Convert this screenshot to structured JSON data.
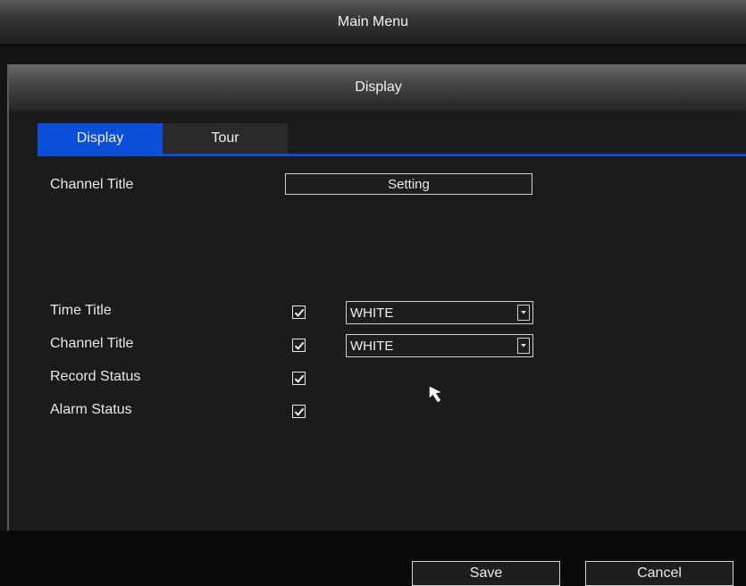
{
  "main_menu": {
    "title": "Main Menu"
  },
  "dialog": {
    "title": "Display",
    "tabs": [
      {
        "label": "Display",
        "active": true
      },
      {
        "label": "Tour",
        "active": false
      }
    ],
    "settings": {
      "channel_title_label": "Channel Title",
      "setting_button": "Setting",
      "rows": [
        {
          "label": "Time Title",
          "checked": true,
          "color": "WHITE"
        },
        {
          "label": "Channel Title",
          "checked": true,
          "color": "WHITE"
        },
        {
          "label": "Record Status",
          "checked": true
        },
        {
          "label": "Alarm Status",
          "checked": true
        }
      ]
    },
    "buttons": {
      "save": "Save",
      "cancel": "Cancel"
    }
  },
  "colors": {
    "accent": "#0b4fd8",
    "background": "#1b1b1b",
    "text": "#e8e8e8"
  }
}
